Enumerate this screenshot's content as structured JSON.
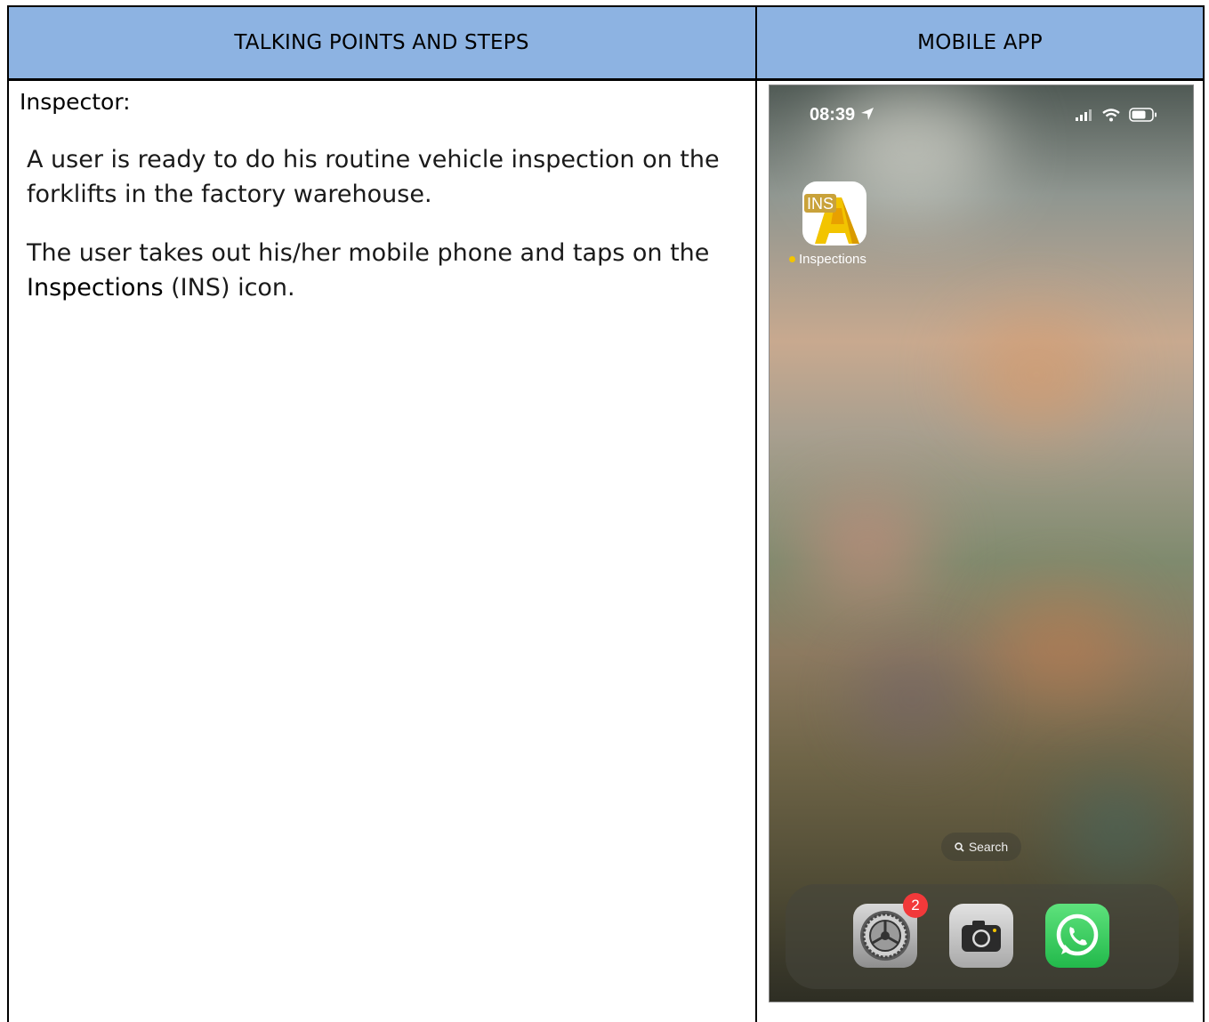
{
  "table": {
    "header_left": "TALKING POINTS AND STEPS",
    "header_right": "MOBILE APP"
  },
  "talking_points": {
    "role": "Inspector:",
    "paragraph_1": "A user is ready to do his routine vehicle inspection on the forklifts in the factory warehouse.",
    "paragraph_2_before": "The user takes out his/her mobile phone and taps on the ",
    "paragraph_2_bold": "Inspections",
    "paragraph_2_after": " (INS) icon."
  },
  "phone": {
    "status_time": "08:39",
    "app": {
      "badge_text": "INS",
      "label": "Inspections",
      "icon": "inspections-app-icon"
    },
    "search_label": "Search",
    "dock": {
      "apps": [
        {
          "name": "settings-app-icon",
          "badge": "2"
        },
        {
          "name": "camera-app-icon"
        },
        {
          "name": "whatsapp-app-icon"
        }
      ]
    },
    "colors": {
      "header_blue": "#8db3e2",
      "whatsapp_green": "#25d366",
      "badge_red": "#f2393a",
      "app_yellow": "#f2c400"
    }
  }
}
